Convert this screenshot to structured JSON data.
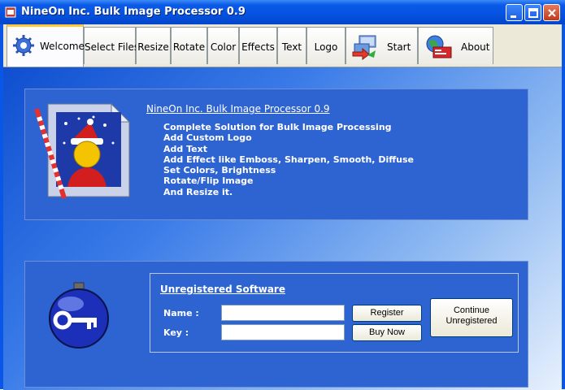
{
  "window": {
    "title": "NineOn Inc. Bulk Image Processor 0.9",
    "icon": "app-icon"
  },
  "titlebar_buttons": [
    {
      "name": "minimize-button",
      "icon": "minimize-icon"
    },
    {
      "name": "maximize-button",
      "icon": "maximize-icon"
    },
    {
      "name": "close-button",
      "icon": "close-icon"
    }
  ],
  "tabs": [
    {
      "label": "Welcome",
      "icon": "gear-icon",
      "active": true
    },
    {
      "label": "Select Files"
    },
    {
      "label": "Resize"
    },
    {
      "label": "Rotate"
    },
    {
      "label": "Color"
    },
    {
      "label": "Effects"
    },
    {
      "label": "Text"
    },
    {
      "label": "Logo"
    },
    {
      "label": "Start",
      "icon": "start-icon"
    },
    {
      "label": "About",
      "icon": "globe-card-icon"
    }
  ],
  "welcome": {
    "heading": "NineOn Inc. Bulk Image Processor 0.9",
    "features": [
      "Complete Solution for Bulk Image Processing",
      "Add Custom Logo",
      "Add Text",
      "Add Effect like Emboss, Sharpen, Smooth, Diffuse",
      "Set Colors, Brightness",
      "Rotate/Flip Image",
      "And Resize it."
    ],
    "image_icon": "santa-image-icon"
  },
  "registration": {
    "title": "Unregistered Software",
    "name_label": "Name :",
    "key_label": "Key :",
    "name_value": "",
    "key_value": "",
    "register_label": "Register",
    "buy_label": "Buy Now",
    "continue_label_1": "Continue",
    "continue_label_2": "Unregistered",
    "key_icon": "key-orb-icon"
  },
  "colors": {
    "titlebar": "#0552df",
    "panel_box": "#2e63d2",
    "active_tab_accent": "#ffc83c"
  }
}
